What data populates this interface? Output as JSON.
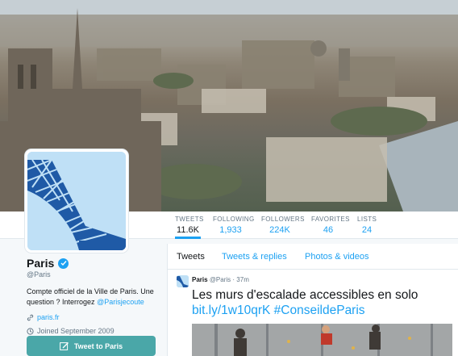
{
  "profile": {
    "name": "Paris",
    "handle": "@Paris",
    "bio_text": "Compte officiel de la Ville de Paris. Une question ? Interrogez ",
    "bio_mention": "@Parisjecoute",
    "website": "paris.fr",
    "joined": "Joined September 2009",
    "tweet_button": "Tweet to Paris"
  },
  "stats": [
    {
      "label": "TWEETS",
      "value": "11.6K",
      "active": true
    },
    {
      "label": "FOLLOWING",
      "value": "1,933"
    },
    {
      "label": "FOLLOWERS",
      "value": "224K"
    },
    {
      "label": "FAVORITES",
      "value": "46"
    },
    {
      "label": "LISTS",
      "value": "24"
    }
  ],
  "tabs": [
    {
      "label": "Tweets",
      "active": true
    },
    {
      "label": "Tweets & replies"
    },
    {
      "label": "Photos & videos"
    }
  ],
  "tweet": {
    "author": "Paris",
    "handle": "@Paris",
    "time": "37m",
    "text": "Les murs d'escalade accessibles en solo",
    "link": "bit.ly/1w10qrK",
    "hashtag": "#ConseildeParis"
  },
  "colors": {
    "accent": "#1da1f2",
    "button": "#4aa7a8",
    "logo_blue": "#1f5aa6",
    "logo_bg": "#bfe0f6"
  },
  "icons": {
    "verified": "verified-badge-icon",
    "link": "link-icon",
    "calendar": "calendar-icon",
    "tweet_button": "compose-icon"
  }
}
